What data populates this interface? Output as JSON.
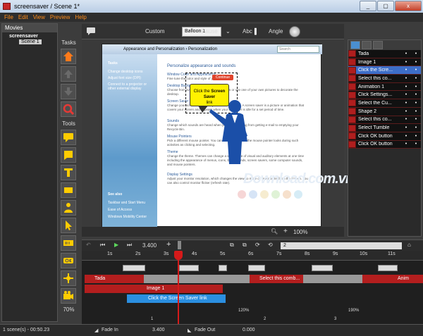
{
  "window": {
    "title": "screensaver / Scene 1*",
    "minimize": "_",
    "maximize": "▢",
    "close": "x"
  },
  "menu": [
    "File",
    "Edit",
    "View",
    "Preview",
    "Help"
  ],
  "movies": {
    "header": "Movies",
    "project": "screensaver",
    "scene": "Scene 1"
  },
  "tasks_label": "Tasks",
  "tools_label": "Tools",
  "zoom": "70%",
  "toolbar": {
    "balloon_value": "Balloon 1",
    "custom": "Custom",
    "pause": "Pause",
    "abc": "Abc",
    "angle": "Angle"
  },
  "screenshot": {
    "address": "Appearance and Personalization › Personalization",
    "search": "Search",
    "nav": [
      "Tasks",
      "Change desktop icons",
      "Adjust font size (DPI)",
      "Connect to a projector or other external display",
      "See also",
      "Taskbar and Start Menu",
      "Ease of Access",
      "Windows Mobility Center"
    ],
    "content_title": "Personalize appearance and sounds",
    "items": [
      {
        "title": "Window Color and Appearance",
        "desc": "Fine tune the color and style of your windows."
      },
      {
        "title": "Desktop Background",
        "desc": "Choose from available backgrounds or colors or use one of your own pictures to decorate the desktop."
      },
      {
        "title": "Screen Saver",
        "desc": "Change your screen saver or adjust when it displays. A screen saver is a picture or animation that covers your screen and appears when your computer is idle for a set period of time."
      },
      {
        "title": "Sounds",
        "desc": "Change which sounds are heard when you do everything from getting e-mail to emptying your Recycle Bin."
      },
      {
        "title": "Mouse Pointers",
        "desc": "Pick a different mouse pointer. You can also change how the mouse pointer looks during such activities as clicking and selecting."
      },
      {
        "title": "Theme",
        "desc": "Change the theme. Themes can change a wide range of visual and auditory elements at one time including the appearance of menus, icons, backgrounds, screen savers, some computer sounds, and mouse pointers."
      },
      {
        "title": "Display Settings",
        "desc": "Adjust your monitor resolution, which changes the view so more or fewer items fit on the screen. You can also control monitor flicker (refresh rate)."
      }
    ],
    "callout_line1": "Click the",
    "callout_bold": "Screen Saver",
    "callout_line2": "link",
    "continue_btn": "Continue",
    "watermark": "Download.com.vn"
  },
  "stage_zoom": "100%",
  "objects": [
    {
      "label": "Tada",
      "selected": false
    },
    {
      "label": "Image 1",
      "selected": false
    },
    {
      "label": "Click the Scre...",
      "selected": true
    },
    {
      "label": "Select this co...",
      "selected": false
    },
    {
      "label": "Animation 1",
      "selected": false
    },
    {
      "label": "Click Settings...",
      "selected": false
    },
    {
      "label": "Select the Cu...",
      "selected": false
    },
    {
      "label": "Shape 2",
      "selected": false
    },
    {
      "label": "Select this co...",
      "selected": false
    },
    {
      "label": "Select Tumble",
      "selected": false
    },
    {
      "label": "Click OK button",
      "selected": false
    },
    {
      "label": "Click OK button",
      "selected": false
    }
  ],
  "timeline": {
    "time": "3.400",
    "page": "2",
    "ruler": [
      "1s",
      "2s",
      "3s",
      "4s",
      "5s",
      "6s",
      "7s",
      "8s",
      "9s",
      "10s",
      "11s"
    ],
    "bars": {
      "tada": "Tada",
      "select": "Select this comb...",
      "anim": "Anim",
      "image": "Image 1",
      "click": "Click the Screen Saver link"
    },
    "pct1": "120%",
    "pct2": "190%",
    "marks": [
      "1",
      "2",
      "3"
    ]
  },
  "status": {
    "scenes": "1 scene(s) - 00:50.23",
    "fade_in": "Fade In",
    "time": "3.400",
    "fade_out": "Fade Out",
    "value": "0.000"
  }
}
